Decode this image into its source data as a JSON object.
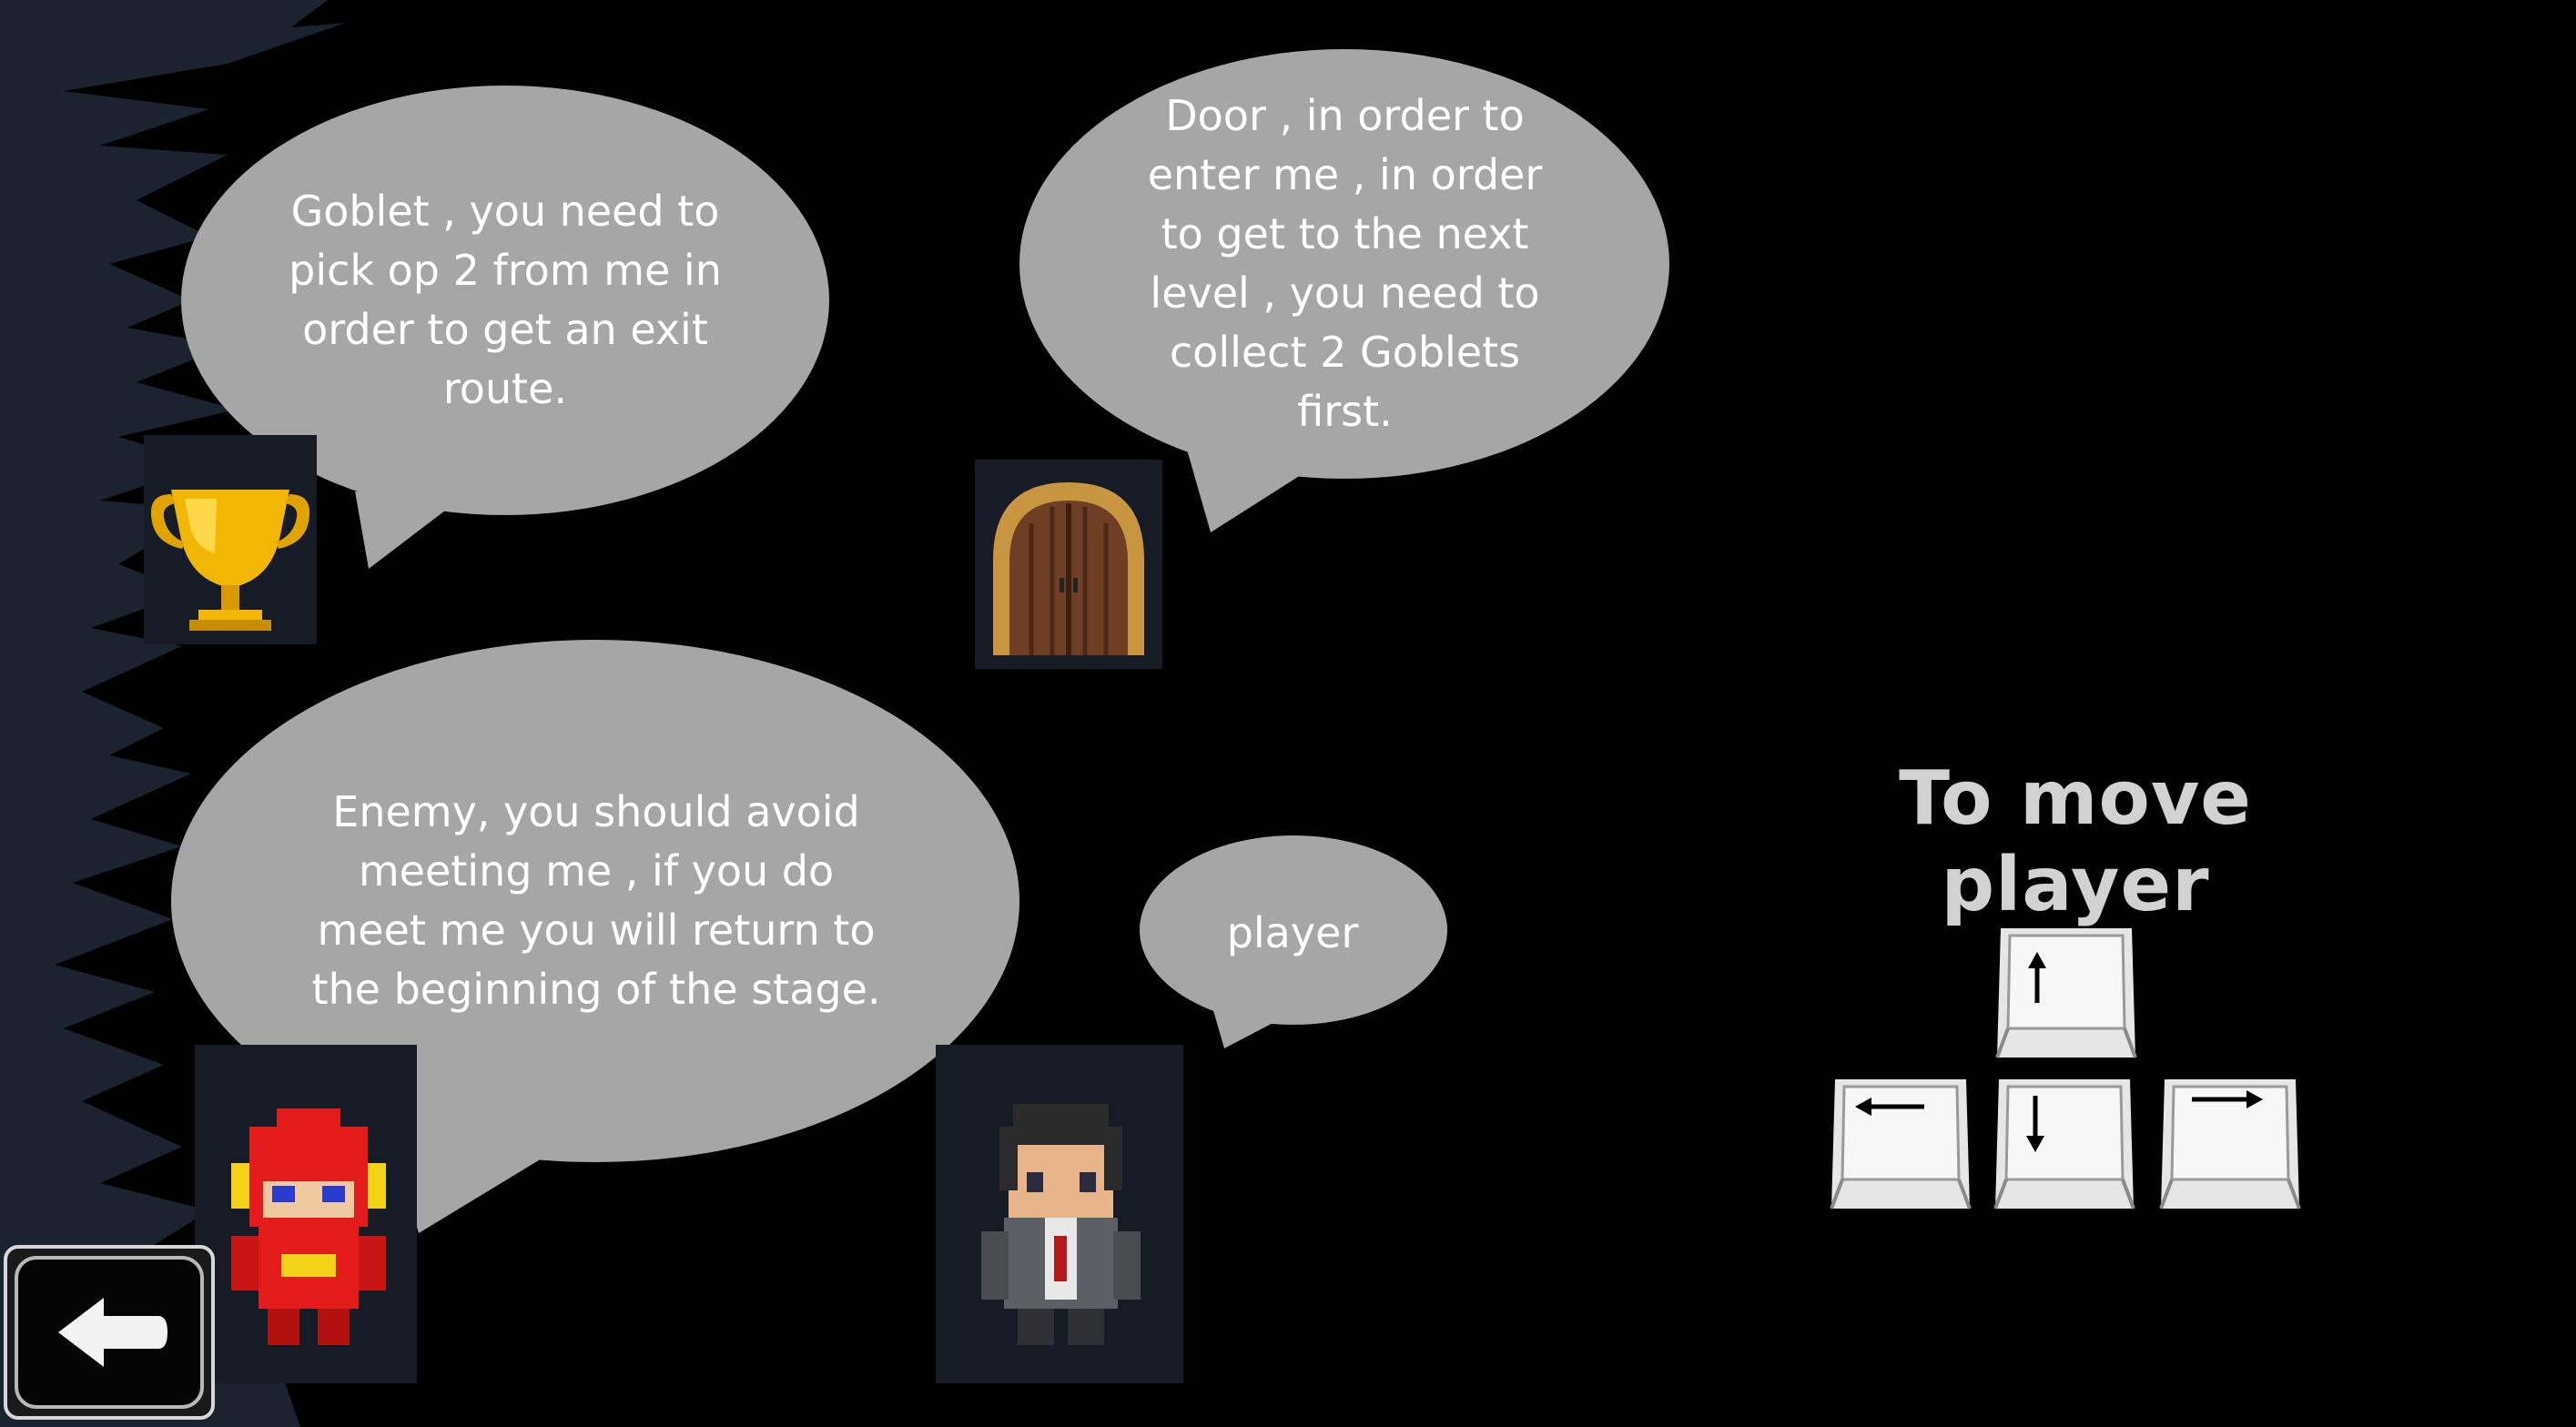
{
  "bubbles": {
    "goblet_text": "Goblet , you need to pick op 2 from me in order to get an exit route.",
    "door_text": "Door , in order to enter me , in order to get to the next level , you need to collect 2 Goblets first.",
    "enemy_text": "Enemy, you should avoid meeting me , if you do meet me you will return to the beginning of the stage.",
    "player_text": "player"
  },
  "controls": {
    "title": "To move player",
    "keys": [
      "up-arrow-icon",
      "left-arrow-icon",
      "down-arrow-icon",
      "right-arrow-icon"
    ]
  },
  "icons": {
    "goblet": "goblet-icon",
    "door": "door-icon",
    "enemy": "enemy-icon",
    "player": "player-icon",
    "back": "back-arrow-icon"
  },
  "colors": {
    "background": "#000000",
    "bubble": "#a6a6a6",
    "left_panel": "#1b2230",
    "sprite_bg": "#161b26",
    "title": "#d2d2d2"
  }
}
